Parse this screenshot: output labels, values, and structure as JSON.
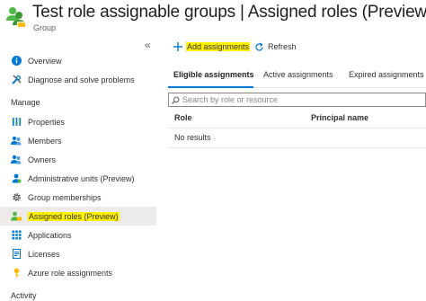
{
  "header": {
    "title": "Test role assignable groups | Assigned roles (Preview)",
    "subtitle": "Group",
    "icon": "group-icon"
  },
  "sidebar": {
    "collapse_glyph": "«",
    "top_items": [
      {
        "label": "Overview",
        "icon": "info-icon"
      },
      {
        "label": "Diagnose and solve problems",
        "icon": "wrench-icon"
      }
    ],
    "manage_label": "Manage",
    "manage_items": [
      {
        "label": "Properties",
        "icon": "properties-icon"
      },
      {
        "label": "Members",
        "icon": "members-icon"
      },
      {
        "label": "Owners",
        "icon": "owners-icon"
      },
      {
        "label": "Administrative units (Preview)",
        "icon": "admin-units-icon"
      },
      {
        "label": "Group memberships",
        "icon": "gear-icon"
      },
      {
        "label": "Assigned roles (Preview)",
        "icon": "assigned-roles-icon",
        "selected": true,
        "highlighted": true
      },
      {
        "label": "Applications",
        "icon": "applications-icon"
      },
      {
        "label": "Licenses",
        "icon": "licenses-icon"
      },
      {
        "label": "Azure role assignments",
        "icon": "key-icon"
      }
    ],
    "activity_label": "Activity"
  },
  "toolbar": {
    "add_label": "Add assignments",
    "refresh_label": "Refresh"
  },
  "tabs": [
    {
      "label": "Eligible assignments",
      "active": true
    },
    {
      "label": "Active assignments",
      "active": false
    },
    {
      "label": "Expired assignments",
      "active": false
    }
  ],
  "search": {
    "placeholder": "Search by role or resource",
    "value": ""
  },
  "grid": {
    "columns": [
      "Role",
      "Principal name"
    ],
    "empty_text": "No results"
  },
  "colors": {
    "accent": "#0078d4",
    "highlight": "#fff200",
    "selected_bg": "#edebe9"
  }
}
